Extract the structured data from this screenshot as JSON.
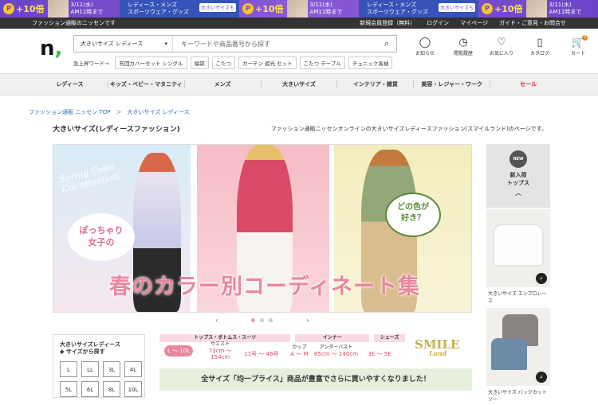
{
  "promo": {
    "units": [
      {
        "point": "P",
        "pct": "+10倍",
        "text": "3/11(水)\nAM11時まで",
        "title": "レディース・メンズ\nスポーツウェア・グッズ",
        "badge": "大きいサイズも"
      },
      {
        "point": "P",
        "pct": "+10倍",
        "text": "3/11(水)\nAM11時まで",
        "title": "レディース・メンズ\nスポーツウェア・グッズ",
        "badge": "大きいサイズも"
      },
      {
        "point": "P",
        "pct": "+10倍",
        "text": "3/11(水)\nAM11時まで",
        "title": "レディース・メンズ\nスポーツウェア・グッズ",
        "badge": "大きいサイズも"
      },
      {
        "point": "P",
        "pct": "+10倍",
        "text": "3/11(水)\nAM11時まで",
        "title": "レディース・メンズ\nスポーツウェア・グッズ",
        "badge": "大きいサイズも"
      },
      {
        "point": "P",
        "pct": "+10倍",
        "text": "3/11(水)\nAM11時まで",
        "title": "レディース・メンズ\nスポーツウェア・グッズ",
        "badge": "大きいサイズも"
      }
    ]
  },
  "topbar": {
    "welcome": "ファッション通販のニッセンです",
    "links": [
      "新規会員登録（無料）",
      "ログイン",
      "マイページ",
      "ガイド・ご意見・お問合せ"
    ]
  },
  "header": {
    "logo_main": "n",
    "logo_dot": ",",
    "search_category": "大きいサイズ レディース",
    "search_placeholder": "キーワードや商品番号から探す",
    "quick_label": "急上昇ワード→",
    "quick_tags": [
      "布団カバーセット シングル",
      "福袋",
      "こたつ",
      "カーテン 遮光 セット",
      "こたつ テーブル",
      "チュニック長袖"
    ],
    "icons": [
      {
        "name": "notice-icon",
        "glyph": "◯",
        "label": "お知らせ"
      },
      {
        "name": "history-icon",
        "glyph": "◷",
        "label": "閲覧履歴"
      },
      {
        "name": "favorite-icon",
        "glyph": "♡",
        "label": "お気に入り"
      },
      {
        "name": "catalog-icon",
        "glyph": "▯",
        "label": "カタログ"
      },
      {
        "name": "cart-icon",
        "glyph": "🛒",
        "label": "カート",
        "badge": "0"
      }
    ]
  },
  "nav": {
    "items": [
      "レディース",
      "キッズ・ベビー・マタニティ",
      "メンズ",
      "大きいサイズ",
      "インテリア・雑貨",
      "美容・レジャー・ワーク",
      "セール"
    ]
  },
  "breadcrumb": "ファッション通販 ニッセン TOP　＞　大きいサイズ レディース",
  "page": {
    "title": "大きいサイズ(レディースファッション)",
    "description": "ファッション通販ニッセンオンラインの大きいサイズレディースファッション(スマイルランド)のページです。"
  },
  "hero": {
    "script_text": "Spring Color\nCoordination!",
    "bubble_left": "ぽっちゃり\n女子の",
    "bubble_right": "どの色が\n好き？",
    "title": "春のカラー別コーディネート集",
    "prev": "‹",
    "next": "›"
  },
  "sidebox": {
    "title": "大きいサイズレディース\n◆ サイズから探す",
    "sizes": [
      "L",
      "LL",
      "3L",
      "4L",
      "5L",
      "6L",
      "8L",
      "10L"
    ]
  },
  "sizechart": {
    "headers": [
      "トップス・ボトムス・スーツ",
      "インナー",
      "シューズ"
    ],
    "range": "L 〜 10L",
    "waist_label": "ウエスト",
    "waist_value": "73cm 〜 154cm",
    "size_value": "11号 〜 46号",
    "cup_label": "カップ",
    "cup_value": "A 〜 M",
    "underbust_label": "アンダーバスト",
    "underbust_value": "85cm 〜 140cm",
    "shoes_value": "3E 〜 5E"
  },
  "smile_logo": {
    "main": "SMILE",
    "sub": "Land"
  },
  "banner2": "全サイズ「均一プライス」商品が豊富でさらに買いやすくなりました！",
  "right": {
    "badge": "NEW",
    "title": "新入荷\nトップス",
    "up": "︿",
    "products": [
      {
        "name": "大きいサイズ エンブロレース"
      },
      {
        "name": "大きいサイズ バックカットソー"
      }
    ]
  }
}
